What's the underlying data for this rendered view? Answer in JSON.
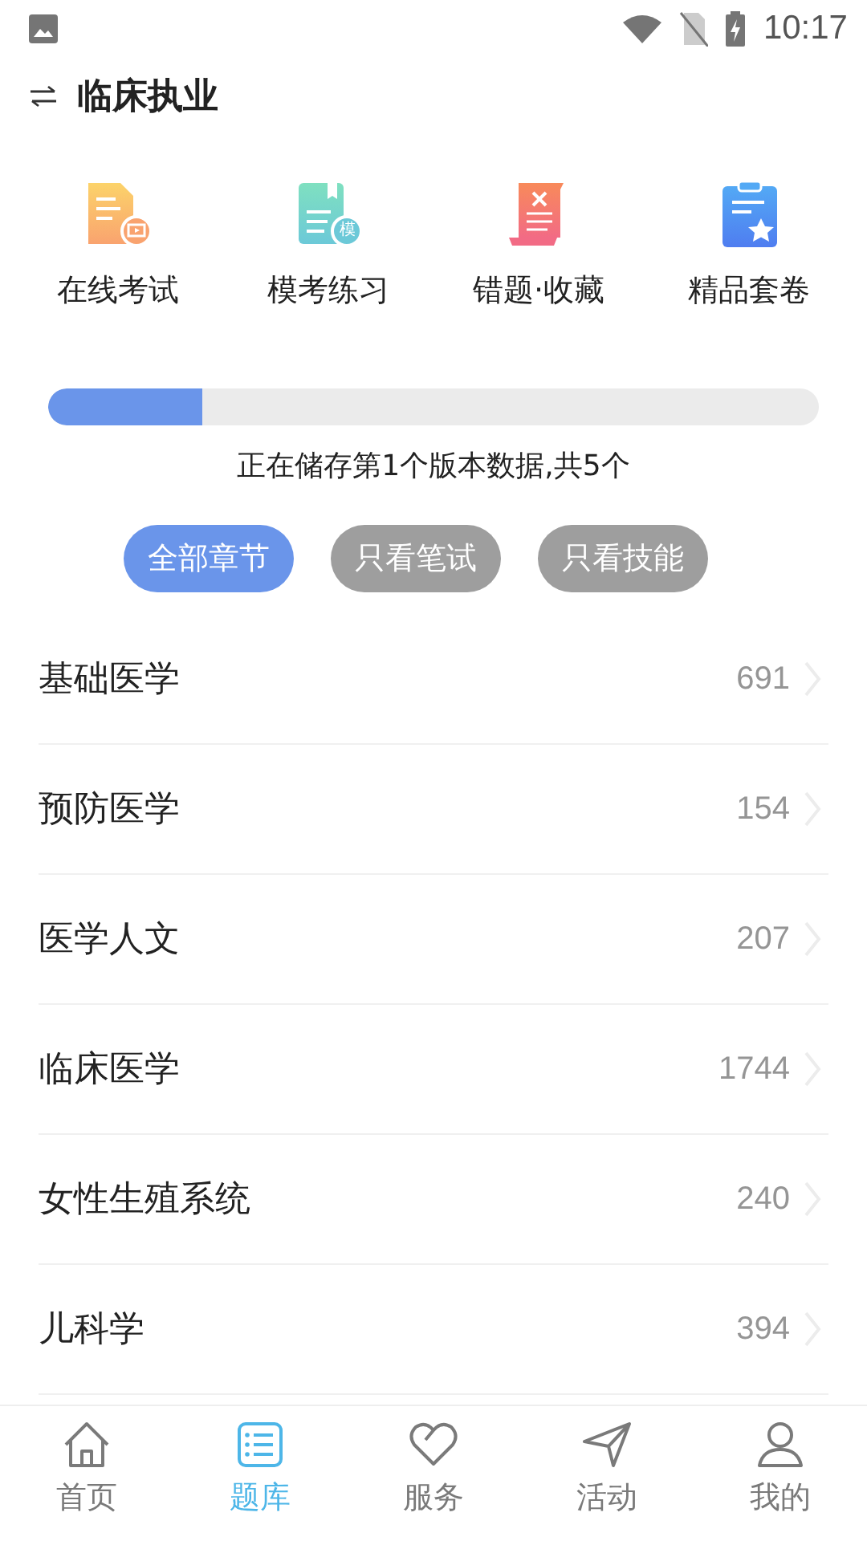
{
  "status_bar": {
    "time": "10:17"
  },
  "header": {
    "title": "临床执业"
  },
  "shortcuts": [
    {
      "label": "在线考试",
      "kind": "exam"
    },
    {
      "label": "模考练习",
      "kind": "mock",
      "badge": "模"
    },
    {
      "label": "错题·收藏",
      "kind": "wrong"
    },
    {
      "label": "精品套卷",
      "kind": "paper"
    }
  ],
  "progress": {
    "level": 0.2,
    "text": "正在储存第1个版本数据,共5个"
  },
  "filters": [
    {
      "label": "全部章节",
      "selected": true
    },
    {
      "label": "只看笔试",
      "selected": false
    },
    {
      "label": "只看技能",
      "selected": false
    }
  ],
  "chapters": [
    {
      "name": "基础医学",
      "count": "691"
    },
    {
      "name": "预防医学",
      "count": "154"
    },
    {
      "name": "医学人文",
      "count": "207"
    },
    {
      "name": "临床医学",
      "count": "1744"
    },
    {
      "name": "女性生殖系统",
      "count": "240"
    },
    {
      "name": "儿科学",
      "count": "394"
    }
  ],
  "tab_bar": [
    {
      "label": "首页",
      "selected": false
    },
    {
      "label": "题库",
      "selected": true
    },
    {
      "label": "服务",
      "selected": false
    },
    {
      "label": "活动",
      "selected": false
    },
    {
      "label": "我的",
      "selected": false
    }
  ]
}
